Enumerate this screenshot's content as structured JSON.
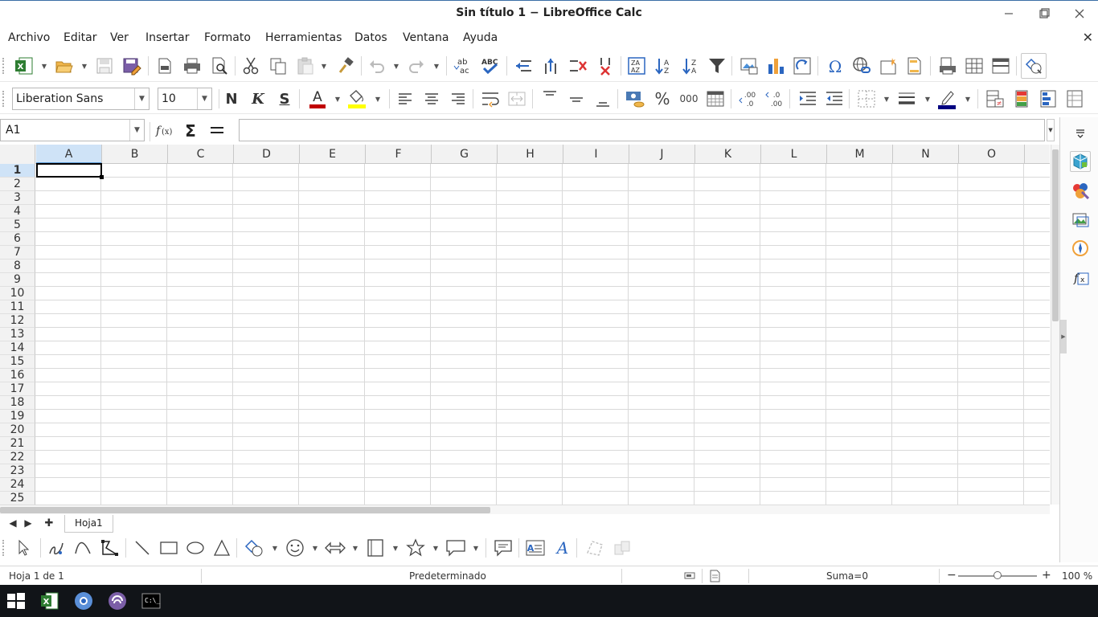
{
  "window": {
    "title": "Sin título 1 − LibreOffice Calc",
    "minimize_icon": "minimize-icon",
    "maximize_icon": "maximize-icon",
    "close_icon": "close-icon"
  },
  "menubar": {
    "items": [
      "Archivo",
      "Editar",
      "Ver",
      "Insertar",
      "Formato",
      "Herramientas",
      "Datos",
      "Ventana",
      "Ayuda"
    ],
    "doc_close": "✕"
  },
  "format_toolbar": {
    "font_name": "Liberation Sans",
    "font_size": "10",
    "bold": "N",
    "italic": "K",
    "underline": "S"
  },
  "formula_bar": {
    "name_box": "A1",
    "formula_value": ""
  },
  "grid": {
    "columns": [
      "A",
      "B",
      "C",
      "D",
      "E",
      "F",
      "G",
      "H",
      "I",
      "J",
      "K",
      "L",
      "M",
      "N",
      "O"
    ],
    "rows": [
      "1",
      "2",
      "3",
      "4",
      "5",
      "6",
      "7",
      "8",
      "9",
      "10",
      "11",
      "12",
      "13",
      "14",
      "15",
      "16",
      "17",
      "18",
      "19",
      "20",
      "21",
      "22",
      "23",
      "24",
      "25"
    ],
    "selected_column": "A",
    "selected_row": "1",
    "active_cell": "A1"
  },
  "sheets": {
    "tabs": [
      "Hoja1"
    ],
    "add_label": "✚"
  },
  "statusbar": {
    "sheet_info": "Hoja 1 de 1",
    "page_style": "Predeterminado",
    "sum": "Suma=0",
    "zoom_minus": "−",
    "zoom_plus": "+",
    "zoom": "100 %",
    "zoom_level_percent": 100
  },
  "colors": {
    "accent": "#5a9bd5",
    "font_color": "#c00000",
    "highlight": "#ffff00",
    "line_color": "#000080",
    "taskbar": "#111418"
  },
  "taskbar": {
    "icons": [
      "windows-start-icon",
      "calc-icon",
      "browser-icon",
      "app-icon",
      "terminal-icon"
    ]
  }
}
